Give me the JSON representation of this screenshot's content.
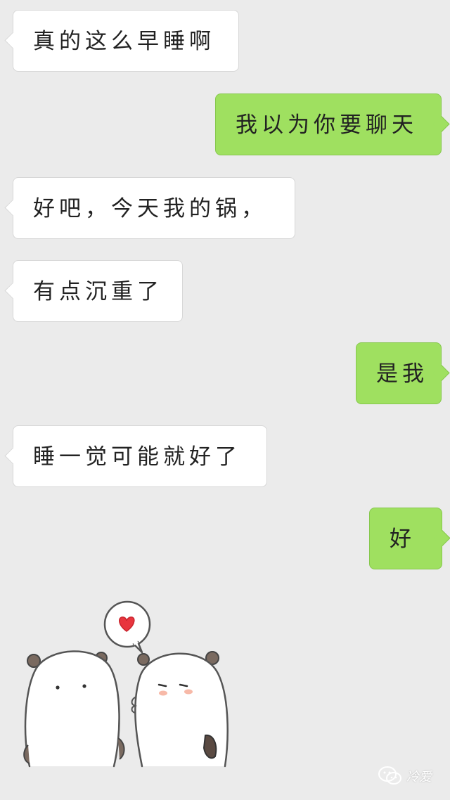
{
  "messages": [
    {
      "side": "incoming",
      "text": "真的这么早睡啊"
    },
    {
      "side": "outgoing",
      "text": "我以为你要聊天"
    },
    {
      "side": "incoming",
      "text": "好吧，今天我的锅，"
    },
    {
      "side": "incoming",
      "text": "有点沉重了"
    },
    {
      "side": "outgoing",
      "text": "是我"
    },
    {
      "side": "incoming",
      "text": "睡一觉可能就好了"
    },
    {
      "side": "outgoing",
      "text": "好"
    }
  ],
  "sticker": {
    "description_icon": "two-bears-heart-sticker"
  },
  "watermark": {
    "icon": "wechat-icon",
    "label": "冷爱"
  },
  "colors": {
    "background": "#ebebeb",
    "incoming_bubble": "#ffffff",
    "outgoing_bubble": "#9fe060",
    "heart": "#e8353e"
  }
}
